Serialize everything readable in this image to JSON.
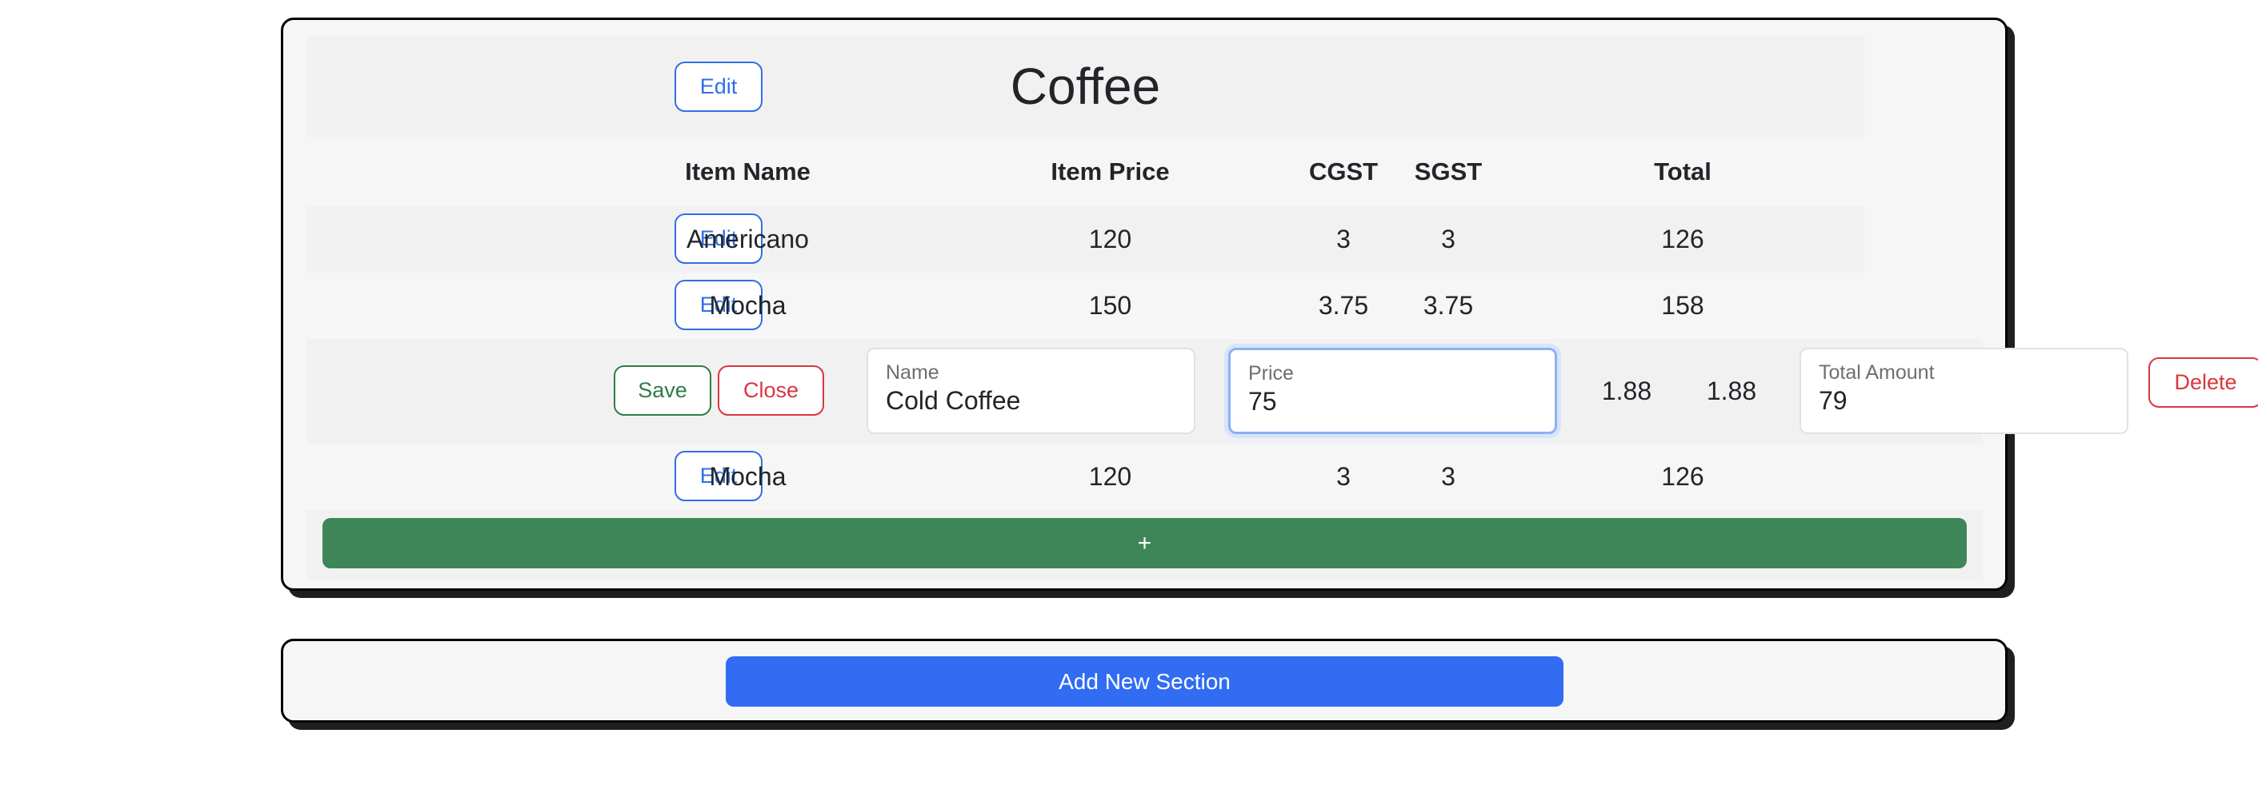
{
  "section": {
    "title": "Coffee",
    "edit_label": "Edit",
    "headers": {
      "name": "Item Name",
      "price": "Item Price",
      "cgst": "CGST",
      "sgst": "SGST",
      "total": "Total"
    },
    "rows": [
      {
        "edit_label": "Edit",
        "name": "Americano",
        "price": "120",
        "cgst": "3",
        "sgst": "3",
        "total": "126"
      },
      {
        "edit_label": "Edit",
        "name": "Mocha",
        "price": "150",
        "cgst": "3.75",
        "sgst": "3.75",
        "total": "158"
      },
      {
        "editing": true,
        "save_label": "Save",
        "close_label": "Close",
        "delete_label": "Delete",
        "name_label": "Name",
        "name_value": "Cold Coffee",
        "price_label": "Price",
        "price_value": "75",
        "cgst": "1.88",
        "sgst": "1.88",
        "total_label": "Total Amount",
        "total_value": "79"
      },
      {
        "edit_label": "Edit",
        "name": "Mocha",
        "price": "120",
        "cgst": "3",
        "sgst": "3",
        "total": "126"
      }
    ],
    "add_item_label": "+"
  },
  "add_section_label": "Add New Section",
  "colors": {
    "primary": "#316cf2",
    "success": "#3e8658",
    "danger": "#d9363e",
    "card_bg": "#f6f6f6"
  }
}
